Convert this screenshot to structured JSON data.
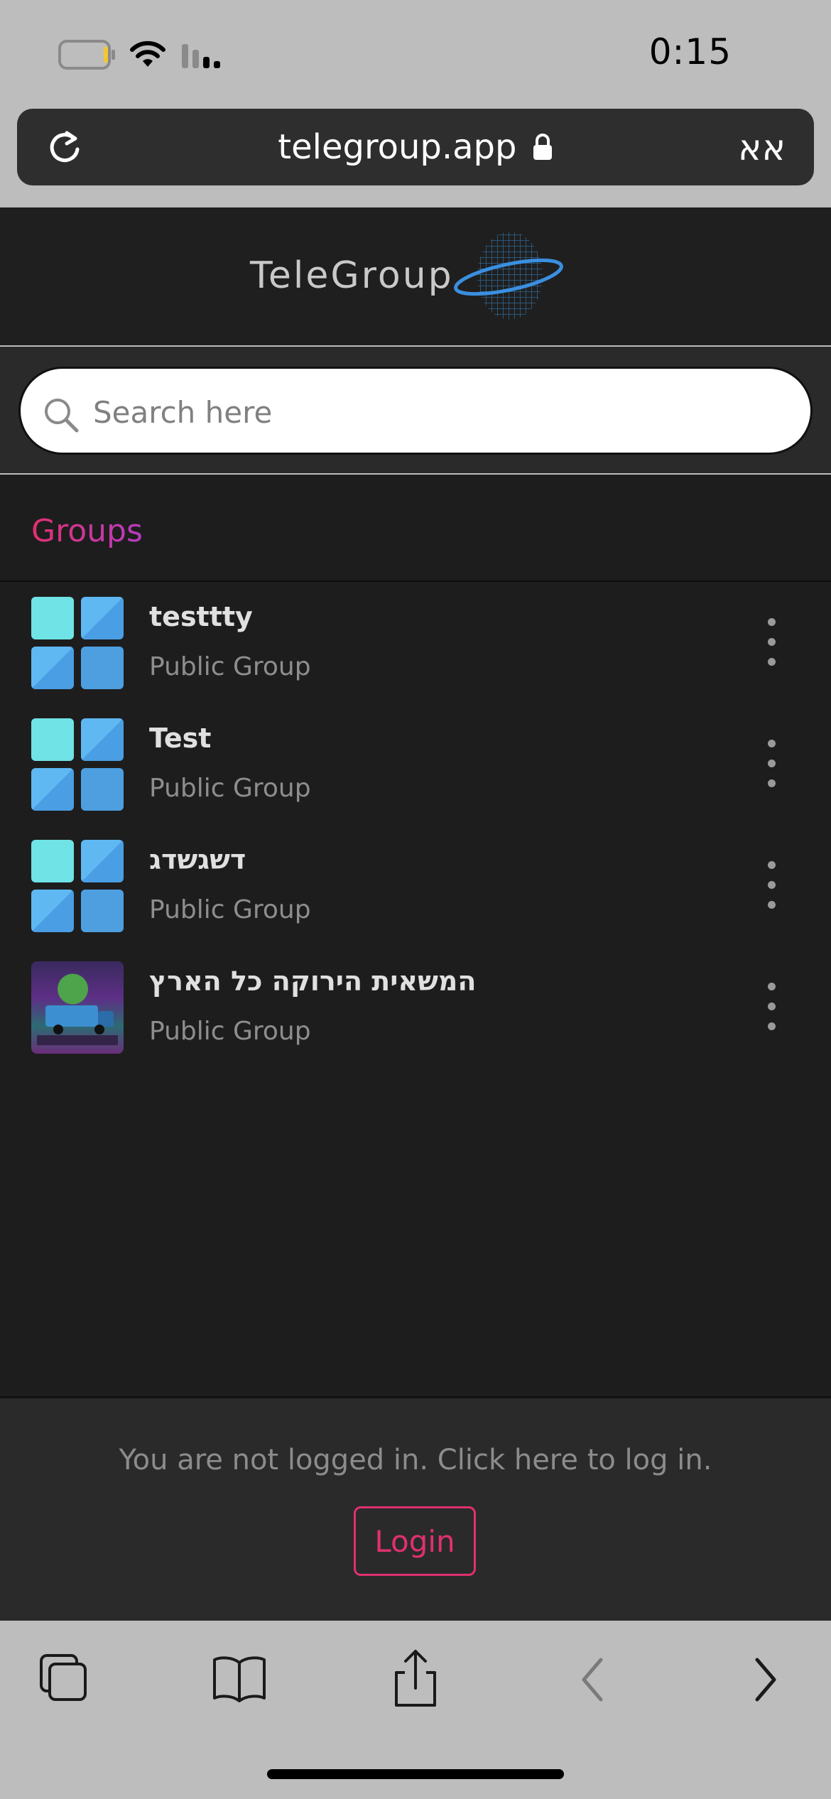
{
  "status_bar": {
    "time": "0:15"
  },
  "browser": {
    "url": "telegroup.app",
    "text_size_button": "אא"
  },
  "site": {
    "logo": "TeleGroup"
  },
  "search": {
    "placeholder": "Search here"
  },
  "groups": {
    "title": "Groups",
    "items": [
      {
        "name": "testtty",
        "type": "Public Group",
        "thumb": "default"
      },
      {
        "name": "Test",
        "type": "Public Group",
        "thumb": "default"
      },
      {
        "name": "דשגשדג",
        "type": "Public Group",
        "thumb": "default"
      },
      {
        "name": "המשאית הירוקה כל הארץ",
        "type": "Public Group",
        "thumb": "photo"
      }
    ]
  },
  "login": {
    "message": "You are not logged in. Click here to log in.",
    "button": "Login"
  },
  "colors": {
    "accent": "#e0306f",
    "background": "#1d1d1d",
    "tile_light": "#6fe3e6",
    "tile_blue": "#4d9fe0"
  },
  "icons": [
    "battery-icon",
    "wifi-icon",
    "cellular-icon",
    "reload-icon",
    "lock-icon",
    "search-icon",
    "more-vertical-icon",
    "tabs-icon",
    "bookmarks-icon",
    "share-icon",
    "back-icon",
    "forward-icon"
  ]
}
